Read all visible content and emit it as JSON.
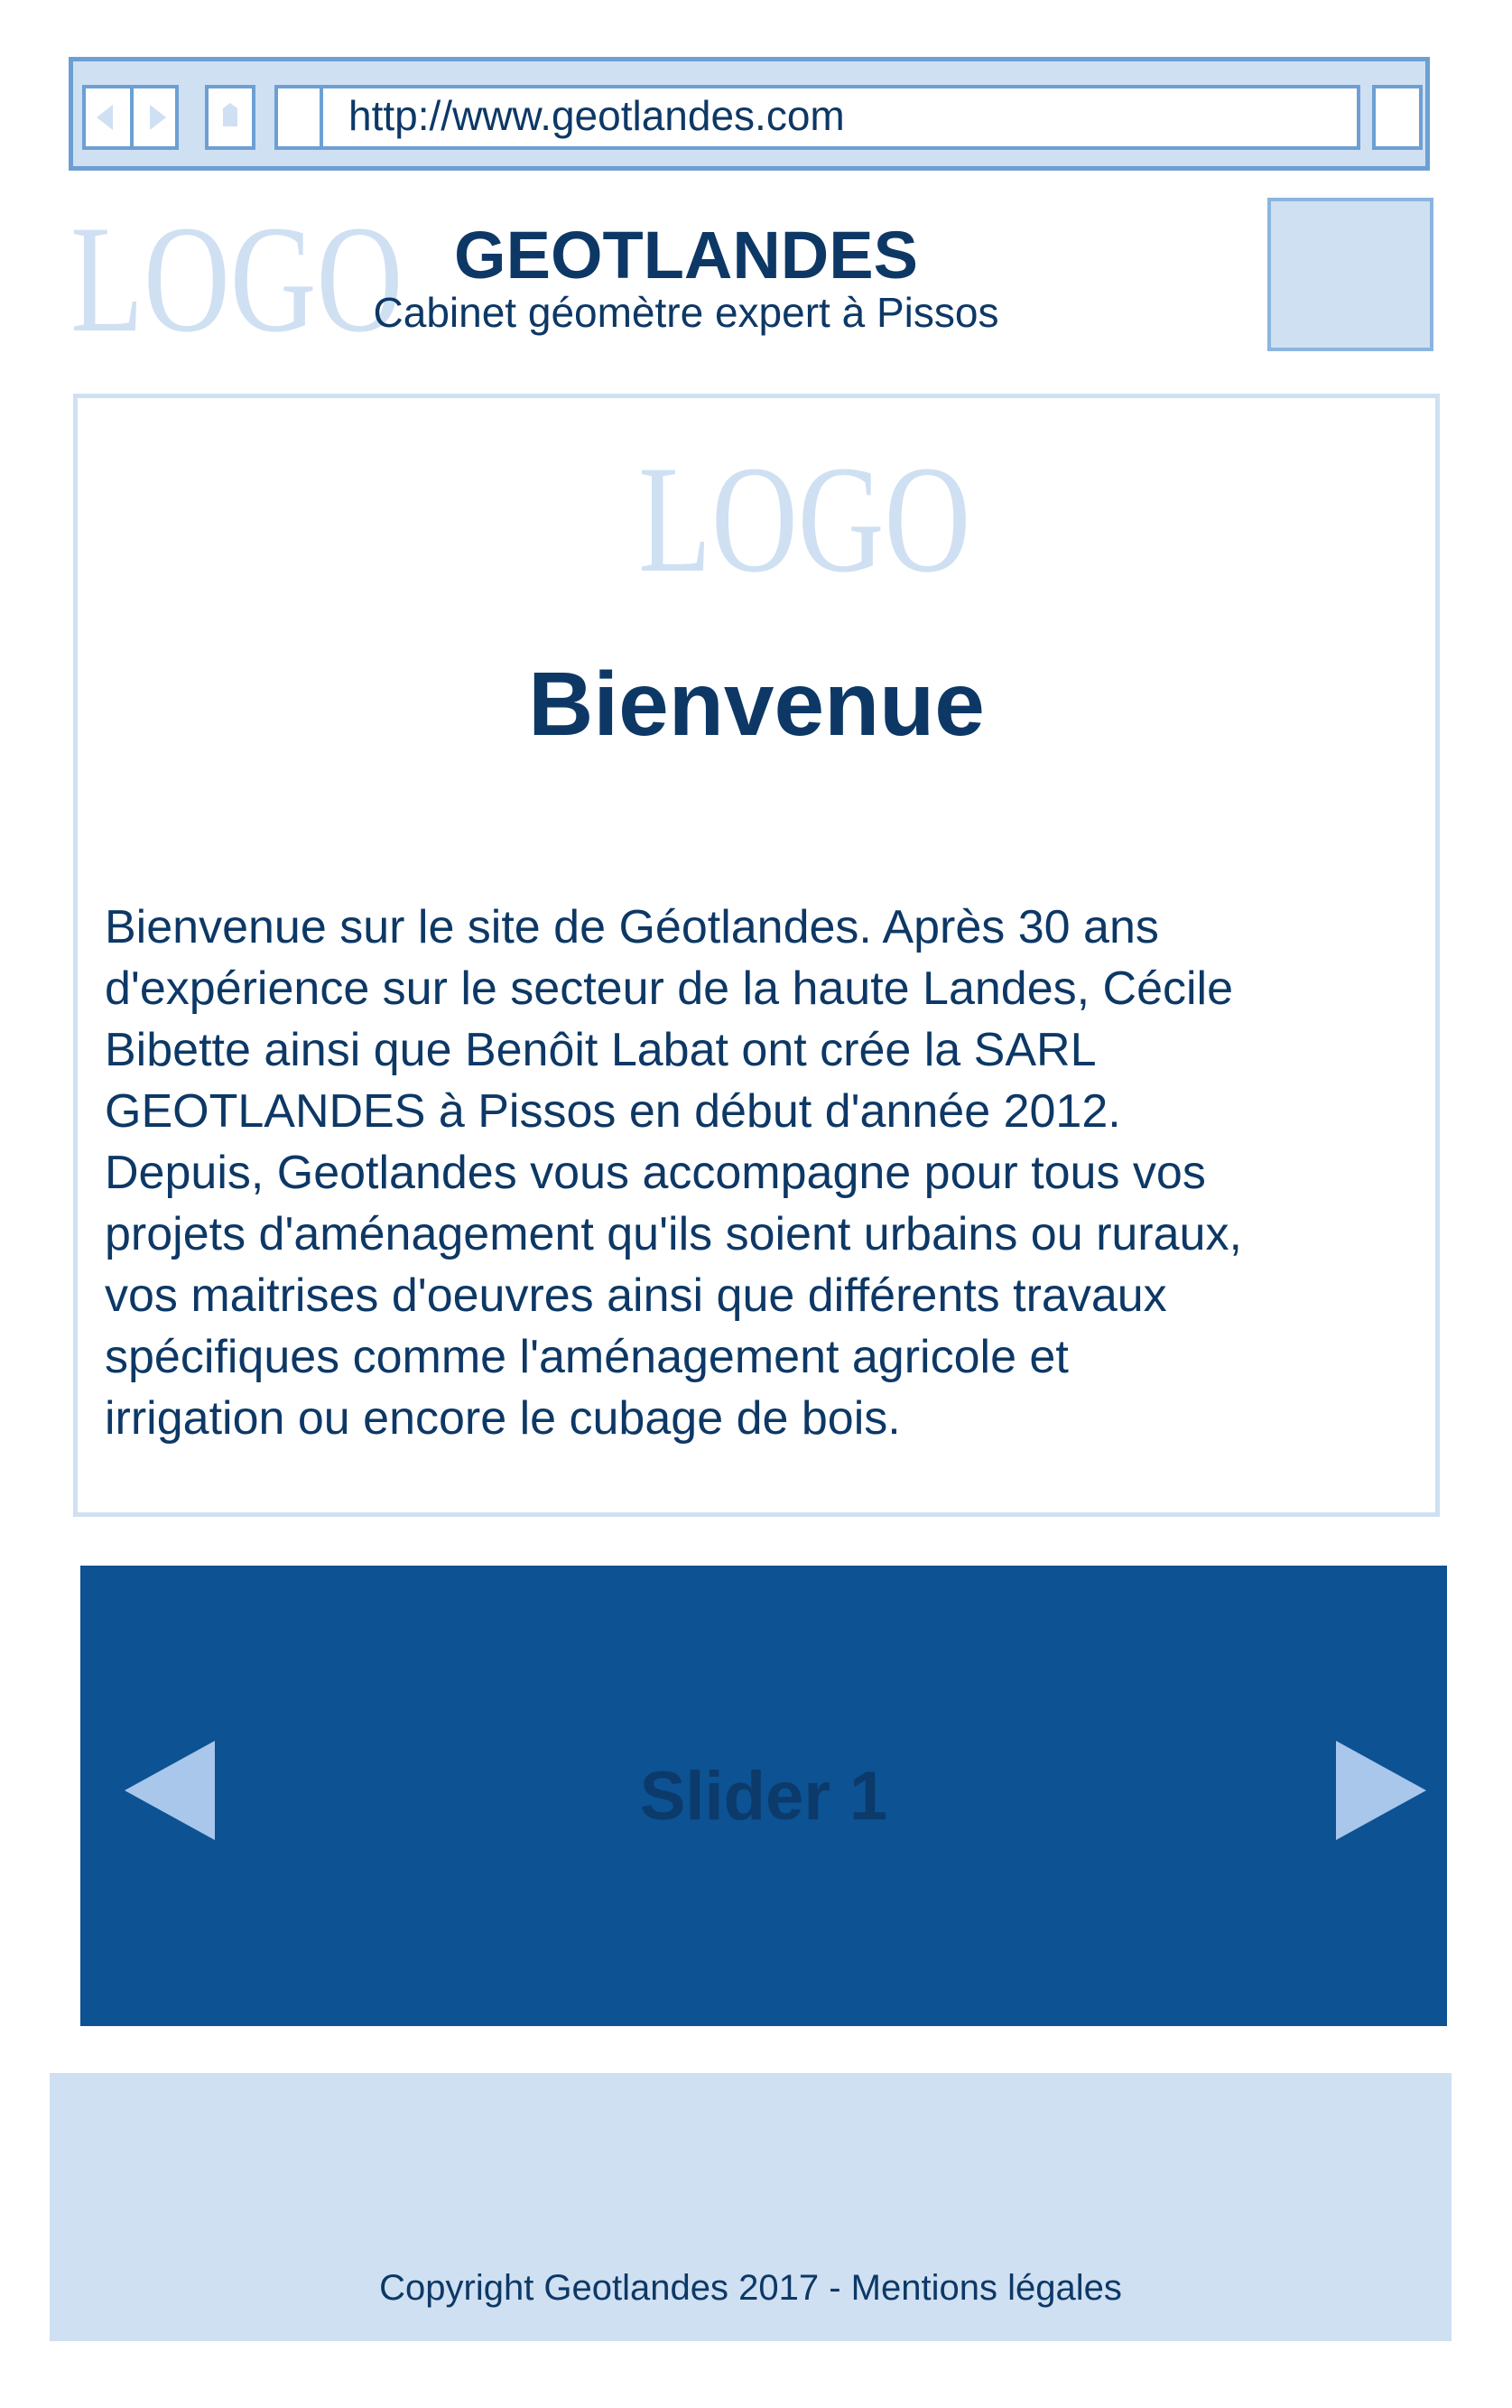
{
  "browser": {
    "url": "http://www.geotlandes.com"
  },
  "header": {
    "logo_text": "LOGO",
    "title": "GEOTLANDES",
    "subtitle": "Cabinet géomètre expert à Pissos"
  },
  "welcome": {
    "logo_text": "LOGO",
    "title": "Bienvenue",
    "lines": [
      "Bienvenue sur le site de Géotlandes. Après 30 ans",
      "d'expérience sur le secteur de la haute Landes, Cécile",
      "Bibette ainsi que Benôit Labat ont crée la SARL",
      "GEOTLANDES à Pissos en début d'année 2012.",
      "Depuis, Geotlandes vous accompagne pour tous vos",
      "projets d'aménagement qu'ils soient urbains ou ruraux,",
      "vos maitrises d'oeuvres ainsi que différents travaux",
      "spécifiques comme  l'aménagement agricole et",
      "irrigation ou encore le cubage de bois."
    ]
  },
  "slider": {
    "label": "Slider 1",
    "prev_icon": "triangle-left-icon",
    "next_icon": "triangle-right-icon"
  },
  "footer": {
    "copyright": "Copyright Geotlandes 2017 - ",
    "legal_link": "Mentions légales"
  },
  "colors": {
    "chrome_border": "#6d9fd4",
    "chrome_fill": "#cfe0f2",
    "text_navy": "#0d3866",
    "slider_bg": "#0d5292",
    "slider_arrow": "#a8c7ea"
  }
}
